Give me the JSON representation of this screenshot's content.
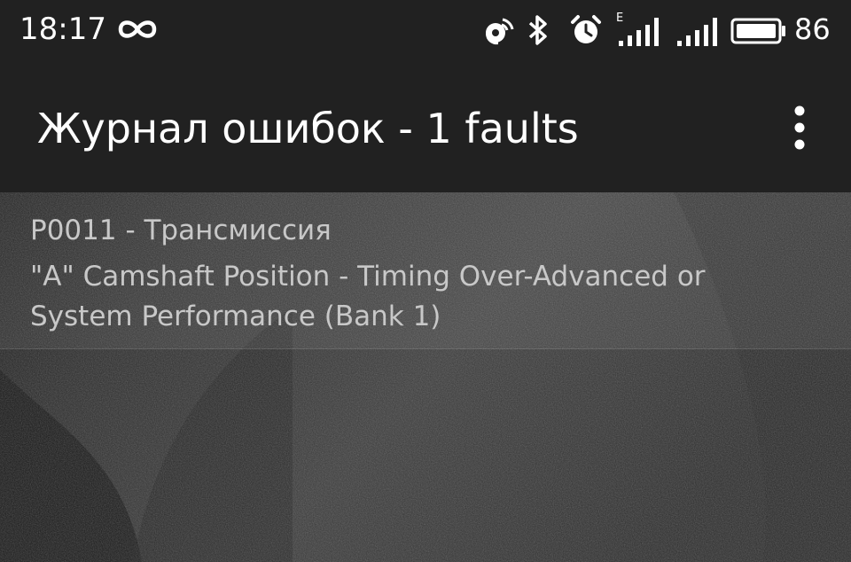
{
  "status_bar": {
    "time": "18:17",
    "battery_level": "86",
    "icons": [
      "infinity-icon",
      "location-icon",
      "bluetooth-icon",
      "alarm-icon",
      "signal-e-icon",
      "signal-icon",
      "battery-icon"
    ],
    "network_label": "E"
  },
  "app_bar": {
    "title": "Журнал ошибок - 1 faults",
    "menu_icon": "overflow-menu-icon"
  },
  "faults": [
    {
      "code_line": "P0011 - Трансмиссия",
      "description": "\"A\" Camshaft Position - Timing Over-Advanced or System Performance (Bank 1)"
    }
  ],
  "colors": {
    "bar_background": "#212121",
    "text_primary": "#ffffff",
    "text_secondary": "#c8c8c8",
    "content_background": "#1a1a1a"
  }
}
